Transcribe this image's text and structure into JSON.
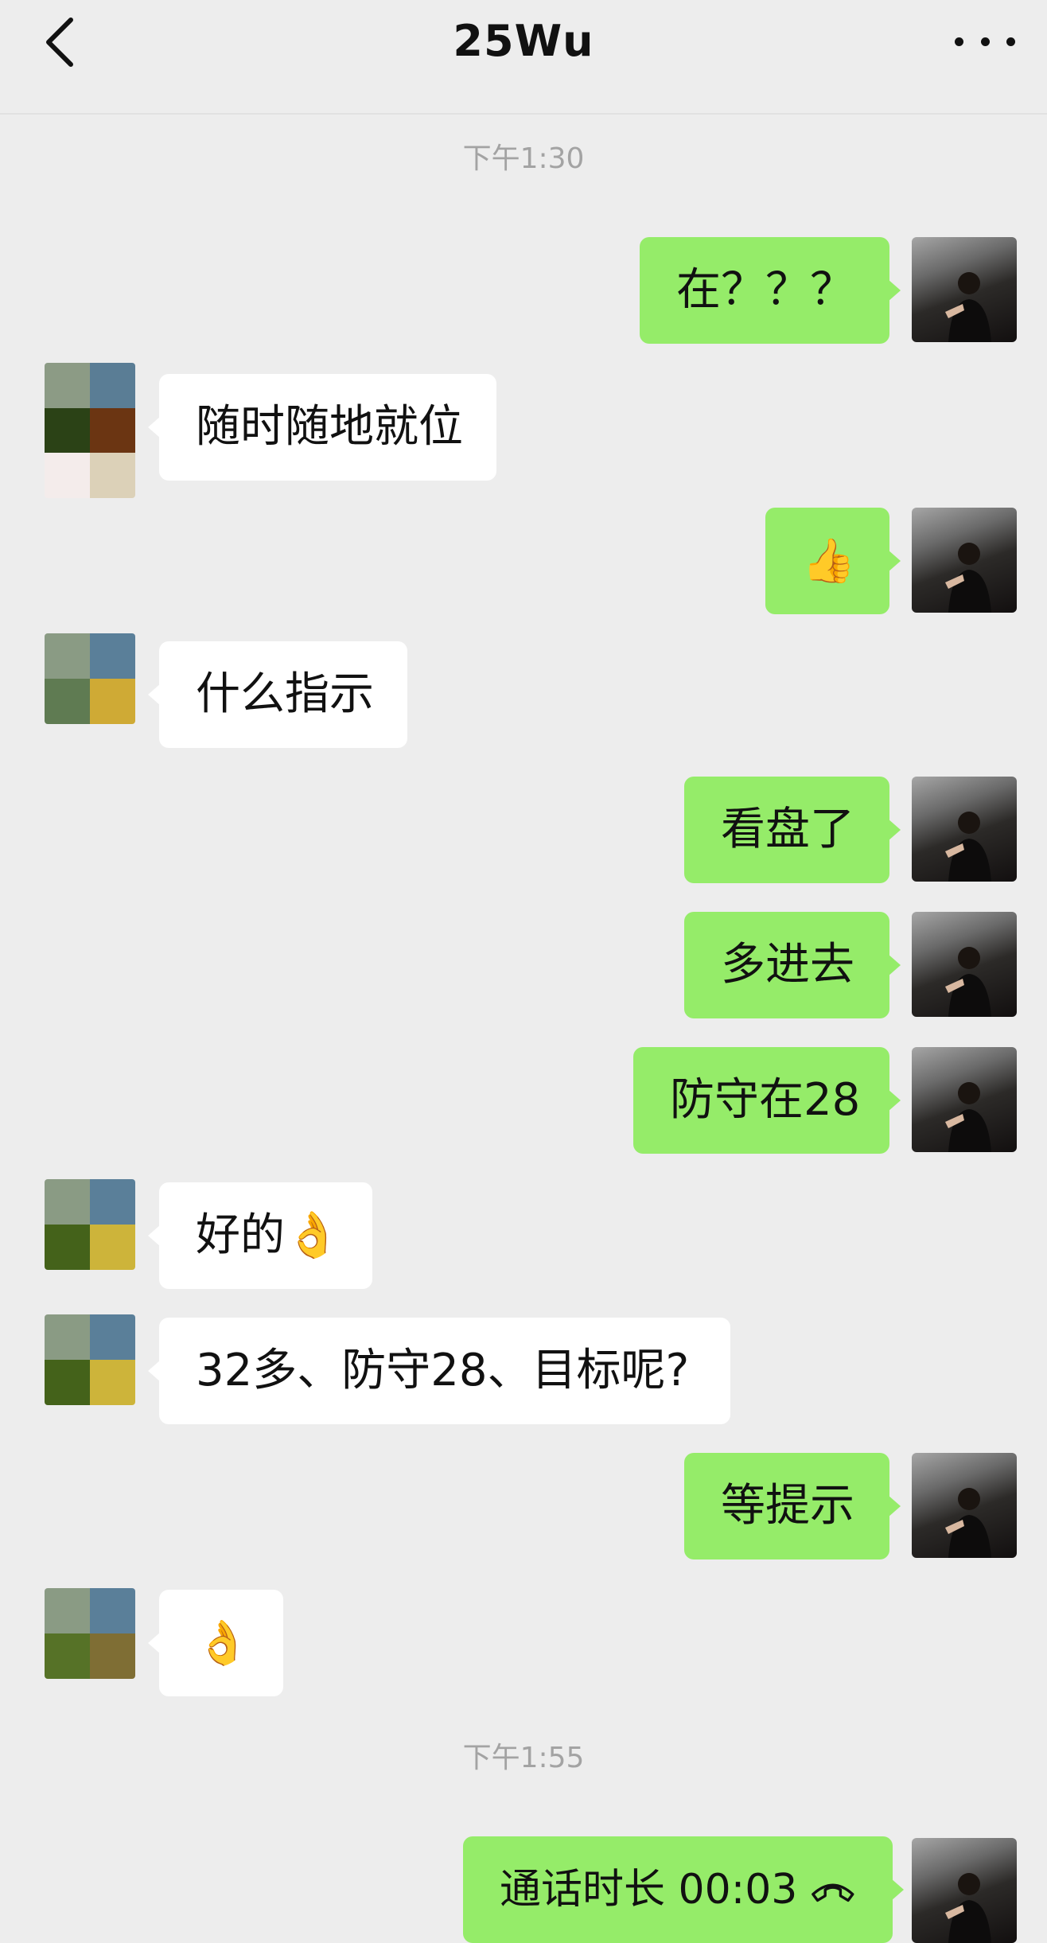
{
  "header": {
    "title": "25Wu",
    "back_icon": "chevron-left-icon",
    "more_icon": "more-dots-icon"
  },
  "timestamps": [
    "下午1:30",
    "下午1:55"
  ],
  "messages": [
    {
      "dir": "out",
      "text": "在？？？"
    },
    {
      "dir": "in",
      "text": "随时随地就位"
    },
    {
      "dir": "out",
      "text": "👍"
    },
    {
      "dir": "in",
      "text": "什么指示"
    },
    {
      "dir": "out",
      "text": "看盘了"
    },
    {
      "dir": "out",
      "text": "多进去"
    },
    {
      "dir": "out",
      "text": "防守在28"
    },
    {
      "dir": "in",
      "text": "好的👌"
    },
    {
      "dir": "in",
      "text": "32多、防守28、目标呢?"
    },
    {
      "dir": "out",
      "text": "等提示"
    },
    {
      "dir": "in",
      "text": "👌"
    },
    {
      "dir": "out",
      "text": "通话时长 00:03"
    }
  ],
  "colors": {
    "background": "#ededed",
    "outgoing_bubble": "#95ec69",
    "incoming_bubble": "#ffffff",
    "timestamp": "#a3a3a3"
  }
}
